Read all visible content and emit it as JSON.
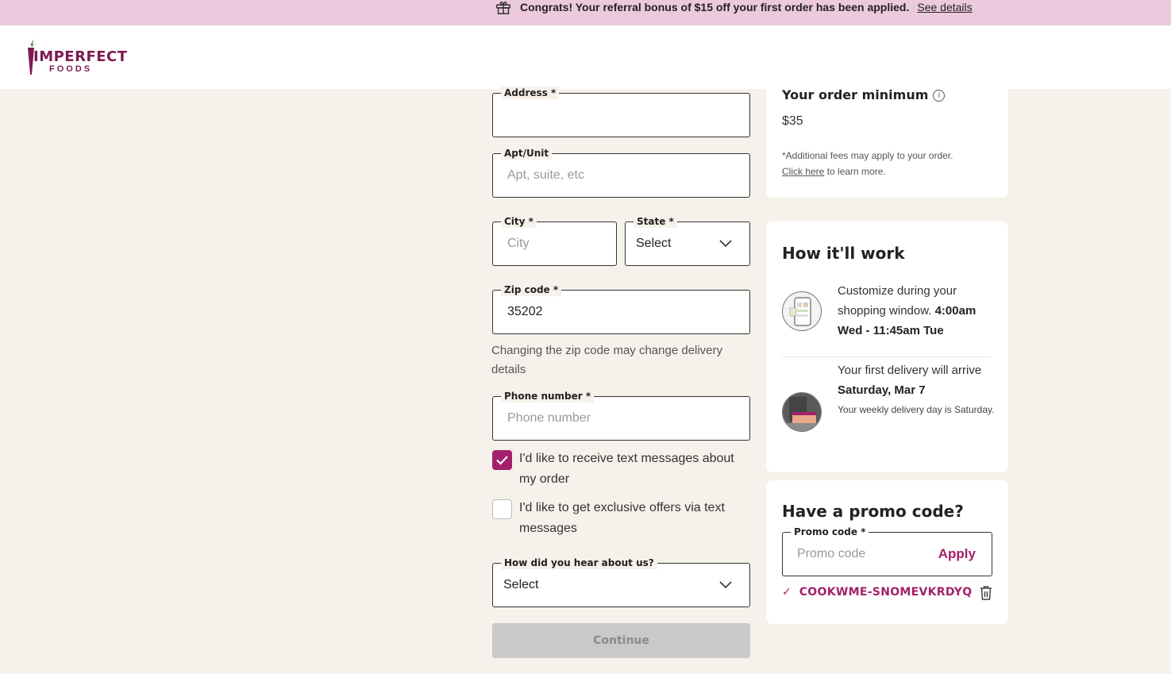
{
  "banner": {
    "icon": "gift-icon",
    "message": "Congrats! Your referral bonus of $15 off your first order has been applied.",
    "link": "See details",
    "bg_color": "#ecc9dc"
  },
  "header": {
    "logo_top": "IMPERFECT",
    "logo_bottom": "FOODS",
    "brand_color": "#7d1a52"
  },
  "form": {
    "address": {
      "label": "Address *",
      "value": "",
      "placeholder": ""
    },
    "apt": {
      "label": "Apt/Unit",
      "placeholder": "Apt, suite, etc"
    },
    "city": {
      "label": "City *",
      "placeholder": "City"
    },
    "state": {
      "label": "State *",
      "value": "Select"
    },
    "zip": {
      "label": "Zip code *",
      "value": "35202"
    },
    "zip_helper": "Changing the zip code may change delivery details",
    "phone": {
      "label": "Phone number *",
      "placeholder": "Phone number"
    },
    "opt_sms": {
      "label": "I'd like to receive text messages about my order",
      "checked": true
    },
    "opt_offers": {
      "label": "I'd like to get exclusive offers via text messages",
      "checked": false
    },
    "hear": {
      "label": "How did you hear about us?",
      "value": "Select"
    },
    "continue_label": "Continue"
  },
  "order_min": {
    "title": "Your order minimum",
    "value": "$35",
    "note": "*Additional fees may apply to your order.",
    "link": "Click here",
    "link_suffix": " to learn more."
  },
  "how": {
    "title": "How it'll work",
    "step1": {
      "line1": "Customize during your shopping window.",
      "bold": "4:00am Wed - 11:45am Tue"
    },
    "step2": {
      "line1": "Your first delivery will arrive",
      "bold": "Saturday, Mar 7",
      "small": "Your weekly delivery day is Saturday."
    }
  },
  "promo": {
    "title": "Have a promo code?",
    "label": "Promo code *",
    "placeholder": "Promo code",
    "apply": "Apply",
    "applied_code": "COOKWME-SNOMEVKRDYQ",
    "accent": "#a3206c"
  }
}
